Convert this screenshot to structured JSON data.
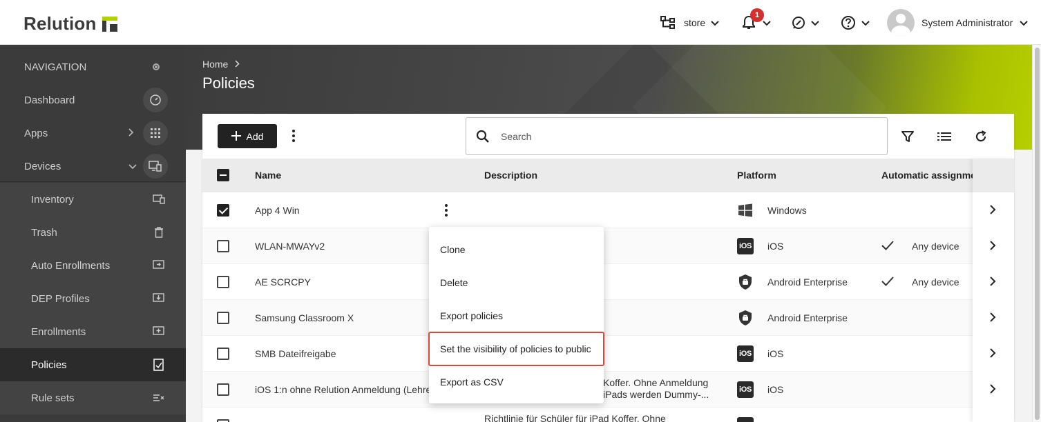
{
  "app": {
    "logo_text": "Relution",
    "brand_color": "#b6cf00"
  },
  "header": {
    "tenant": "store",
    "notification_count": "1",
    "user_name": "System Administrator"
  },
  "sidebar": {
    "title": "NAVIGATION",
    "items": [
      {
        "label": "Dashboard",
        "icon": "speedometer-icon"
      },
      {
        "label": "Apps",
        "icon": "grid-icon"
      },
      {
        "label": "Devices",
        "icon": "devices-icon"
      },
      {
        "label": "Inventory",
        "icon": "inventory-icon"
      },
      {
        "label": "Trash",
        "icon": "trash-icon"
      },
      {
        "label": "Auto Enrollments",
        "icon": "auto-enroll-icon"
      },
      {
        "label": "DEP Profiles",
        "icon": "dep-profile-icon"
      },
      {
        "label": "Enrollments",
        "icon": "enrollment-icon"
      },
      {
        "label": "Policies",
        "icon": "policy-icon"
      },
      {
        "label": "Rule sets",
        "icon": "ruleset-icon"
      }
    ]
  },
  "page": {
    "breadcrumb": "Home",
    "title": "Policies"
  },
  "toolbar": {
    "add_label": "Add",
    "search_placeholder": "Search"
  },
  "table": {
    "columns": [
      "Name",
      "Description",
      "Platform",
      "Automatic assignme"
    ],
    "rows": [
      {
        "name": "App 4 Win",
        "description": "",
        "platform": "Windows",
        "assignment": "",
        "checked": true
      },
      {
        "name": "WLAN-MWAYv2",
        "description": "",
        "platform": "iOS",
        "assignment": "Any device",
        "checked": false
      },
      {
        "name": "AE SCRCPY",
        "description": "",
        "platform": "Android Enterprise",
        "assignment": "Any device",
        "checked": false
      },
      {
        "name": "Samsung Classroom X",
        "description": "",
        "platform": "Android Enterprise",
        "assignment": "",
        "checked": false
      },
      {
        "name": "SMB Dateifreigabe",
        "description": "",
        "platform": "iOS",
        "assignment": "",
        "checked": false
      },
      {
        "name": "iOS 1:n ohne Relution Anmeldung (Lehre",
        "description_line1": "Koffer. Ohne Anmeldung",
        "description_line2": "iPads werden Dummy-...",
        "platform": "iOS",
        "assignment": "",
        "checked": false
      },
      {
        "name": "",
        "description_line1": "Richtlinie für Schüler für iPad Koffer. Ohne",
        "platform": "",
        "assignment": "",
        "checked": false
      }
    ]
  },
  "context_menu": {
    "items": [
      "Clone",
      "Delete",
      "Export policies",
      "Set the visibility of policies to public",
      "Export as CSV"
    ],
    "highlight_color": "#e0473b"
  }
}
